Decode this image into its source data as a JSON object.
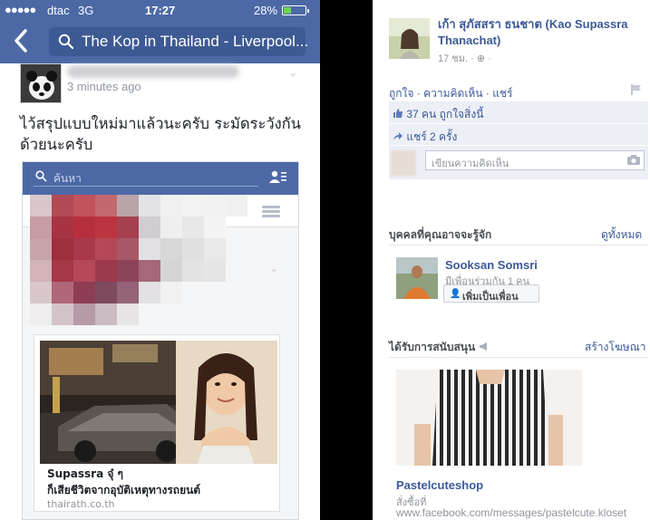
{
  "phone": {
    "status": {
      "signal": "●●●●●",
      "carrier": "dtac",
      "network": "3G",
      "time": "17:27",
      "battery": "28%"
    },
    "nav": {
      "back_glyph": "‹",
      "search_text": "The Kop in Thailand - Liverpool..."
    },
    "post": {
      "time_ago": "3 minutes ago",
      "text": "ไว้สรุปแบบใหม่มาแล้วนะครับ ระมัดระวังกันด้วยนะครับ",
      "embed": {
        "search_placeholder": "ค้นหา",
        "card_title": "Supassra จุ๋ ๆ",
        "card_subtitle": "ก็เสียชีวิตจากอุบัติเหตุทางรถยนต์",
        "card_source": "thairath.co.th"
      }
    }
  },
  "desktop": {
    "author": {
      "name": "เก้า สุภัสสรา ธนชาต (Kao Supassra Thanachat)",
      "meta": "17 ชม. · ⊕ ·"
    },
    "actions": "ถูกใจ · ความคิดเห็น · แชร์",
    "likes": "37 คน ถูกใจสิ่งนี้",
    "shares": "แชร์ 2 ครั้ง",
    "comment_placeholder": "เขียนความคิดเห็น",
    "pymk": {
      "heading": "บุคคลที่คุณอาจจะรู้จัก",
      "see_all": "ดูทั้งหมด",
      "person_name": "Sooksan Somsri",
      "mutual": "มีเพื่อนร่วมกัน 1 คน",
      "add_button": "เพิ่มเป็นเพื่อน"
    },
    "sponsored": {
      "heading": "ได้รับการสนับสนุน",
      "create_ad": "สร้างโฆษณา",
      "ad_name": "Pastelcuteshop",
      "ad_cta": "สั่งซื้อที่",
      "ad_url": "www.facebook.com/messages/pastelcute.kloset"
    }
  },
  "colors": {
    "fb_blue": "#4c69a6",
    "link_blue": "#3b5998",
    "battery_green": "#6fd35a"
  }
}
